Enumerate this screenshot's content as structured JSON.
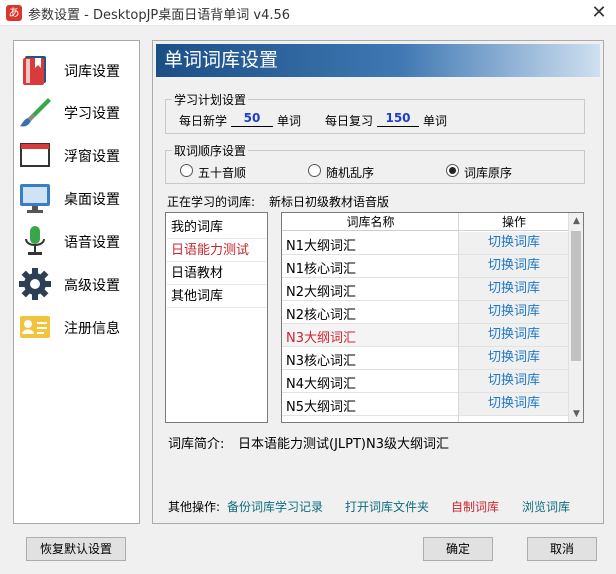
{
  "window": {
    "title": "参数设置 - DesktopJP桌面日语背单词 v4.56",
    "app_icon": "あ",
    "close": "✕"
  },
  "sidebar": {
    "items": [
      {
        "label": "词库设置",
        "icon": "book-icon"
      },
      {
        "label": "学习设置",
        "icon": "brush-icon"
      },
      {
        "label": "浮窗设置",
        "icon": "window-icon"
      },
      {
        "label": "桌面设置",
        "icon": "monitor-icon"
      },
      {
        "label": "语音设置",
        "icon": "microphone-icon"
      },
      {
        "label": "高级设置",
        "icon": "gear-icon"
      },
      {
        "label": "注册信息",
        "icon": "id-card-icon"
      }
    ]
  },
  "panel": {
    "title": "单词词库设置"
  },
  "plan": {
    "group_title": "学习计划设置",
    "daily_new_label": "每日新学",
    "daily_new_value": "50",
    "daily_review_label": "每日复习",
    "daily_review_value": "150",
    "unit": "单词"
  },
  "order": {
    "group_title": "取词顺序设置",
    "options": [
      {
        "label": "五十音顺",
        "checked": false
      },
      {
        "label": "随机乱序",
        "checked": false
      },
      {
        "label": "词库原序",
        "checked": true
      }
    ]
  },
  "current": {
    "label": "正在学习的词库:",
    "value": "新标日初级教材语音版"
  },
  "categories": [
    "我的词库",
    "日语能力测试",
    "日语教材",
    "其他词库"
  ],
  "selected_category": 1,
  "table": {
    "col_name": "词库名称",
    "col_action": "操作",
    "rows": [
      {
        "name": "N1大纲词汇",
        "action": "切换词库"
      },
      {
        "name": "N1核心词汇",
        "action": "切换词库"
      },
      {
        "name": "N2大纲词汇",
        "action": "切换词库"
      },
      {
        "name": "N2核心词汇",
        "action": "切换词库"
      },
      {
        "name": "N3大纲词汇",
        "action": "切换词库"
      },
      {
        "name": "N3核心词汇",
        "action": "切换词库"
      },
      {
        "name": "N4大纲词汇",
        "action": "切换词库"
      },
      {
        "name": "N5大纲词汇",
        "action": "切换词库"
      }
    ],
    "current_row": 4
  },
  "intro": {
    "label": "词库简介:",
    "text": "日本语能力测试(JLPT)N3级大纲词汇"
  },
  "other_ops": {
    "label": "其他操作:",
    "backup": "备份词库学习记录",
    "open_folder": "打开词库文件夹",
    "custom": "自制词库",
    "browse": "浏览词库"
  },
  "buttons": {
    "restore": "恢复默认设置",
    "ok": "确定",
    "cancel": "取消"
  },
  "colors": {
    "accent_red": "#c8272f",
    "link_blue": "#1f78c4",
    "link_teal": "#0d6d7e",
    "header_blue": "#1a4f86",
    "input_blue": "#1d3ec9"
  }
}
